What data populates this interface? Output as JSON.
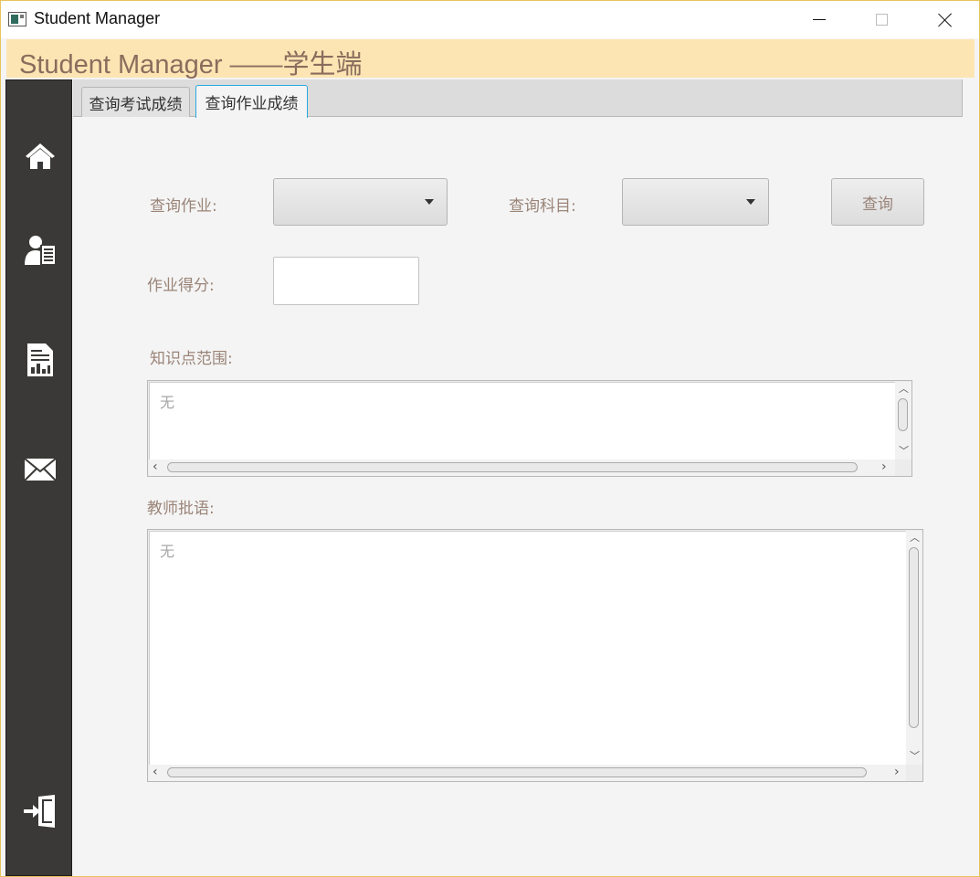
{
  "window": {
    "title": "Student Manager"
  },
  "header": {
    "title": "Student Manager ——学生端",
    "bg_color": "#fde5b3"
  },
  "sidebar": {
    "items": [
      {
        "icon": "home-icon"
      },
      {
        "icon": "user-list-icon"
      },
      {
        "icon": "report-chart-icon"
      },
      {
        "icon": "mail-icon"
      },
      {
        "icon": "logout-door-icon"
      }
    ]
  },
  "tabs": [
    {
      "label": "查询考试成绩",
      "active": false
    },
    {
      "label": "查询作业成绩",
      "active": true
    }
  ],
  "form": {
    "homework_label": "查询作业:",
    "homework_value": "",
    "subject_label": "查询科目:",
    "subject_value": "",
    "query_button": "查询",
    "score_label": "作业得分:",
    "score_value": "",
    "knowledge_label": "知识点范围:",
    "knowledge_text": "无",
    "comment_label": "教师批语:",
    "comment_text": "无"
  }
}
